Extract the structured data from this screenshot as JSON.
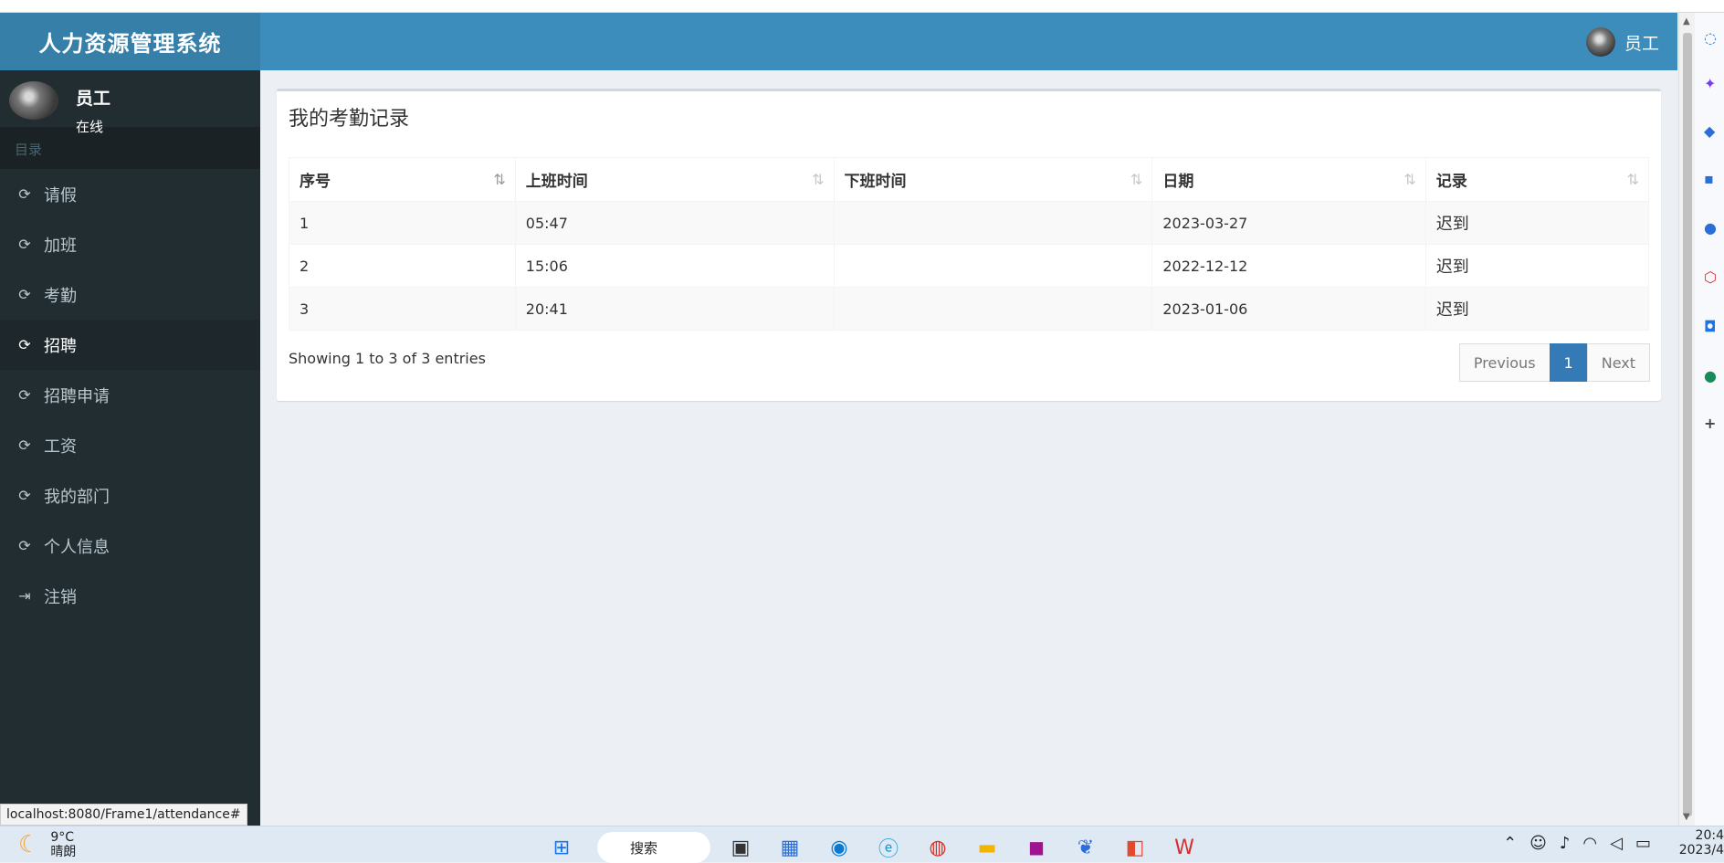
{
  "app": {
    "title": "人力资源管理系统",
    "user_name": "员工",
    "user_status": "在线"
  },
  "sidebar": {
    "header": "目录",
    "items": [
      {
        "label": "请假",
        "icon": "refresh-icon"
      },
      {
        "label": "加班",
        "icon": "refresh-icon"
      },
      {
        "label": "考勤",
        "icon": "refresh-icon"
      },
      {
        "label": "招聘",
        "icon": "refresh-icon"
      },
      {
        "label": "招聘申请",
        "icon": "refresh-icon"
      },
      {
        "label": "工资",
        "icon": "refresh-icon"
      },
      {
        "label": "我的部门",
        "icon": "refresh-icon"
      },
      {
        "label": "个人信息",
        "icon": "refresh-icon"
      },
      {
        "label": "注销",
        "icon": "sign-out-icon"
      }
    ]
  },
  "header": {
    "user_label": "员工"
  },
  "main": {
    "box_title": "我的考勤记录",
    "table": {
      "columns": [
        "序号",
        "上班时间",
        "下班时间",
        "日期",
        "记录"
      ],
      "rows": [
        [
          "1",
          "05:47",
          "",
          "2023-03-27",
          "迟到"
        ],
        [
          "2",
          "15:06",
          "",
          "2022-12-12",
          "迟到"
        ],
        [
          "3",
          "20:41",
          "",
          "2023-01-06",
          "迟到"
        ]
      ]
    },
    "info": "Showing 1 to 3 of 3 entries",
    "pagination": {
      "previous": "Previous",
      "current": "1",
      "next": "Next"
    }
  },
  "status_bar": {
    "url": "localhost:8080/Frame1/attendance#"
  },
  "taskbar": {
    "weather_temp": "9°C",
    "weather_desc": "晴朗",
    "search_label": "搜索",
    "clock_time": "20:4",
    "clock_date": "2023/4"
  },
  "colors": {
    "header_bg": "#3c8dbc",
    "logo_bg": "#367fa9",
    "sidebar_bg": "#222d32",
    "content_bg": "#ecf0f5",
    "pager_active": "#337ab7"
  }
}
